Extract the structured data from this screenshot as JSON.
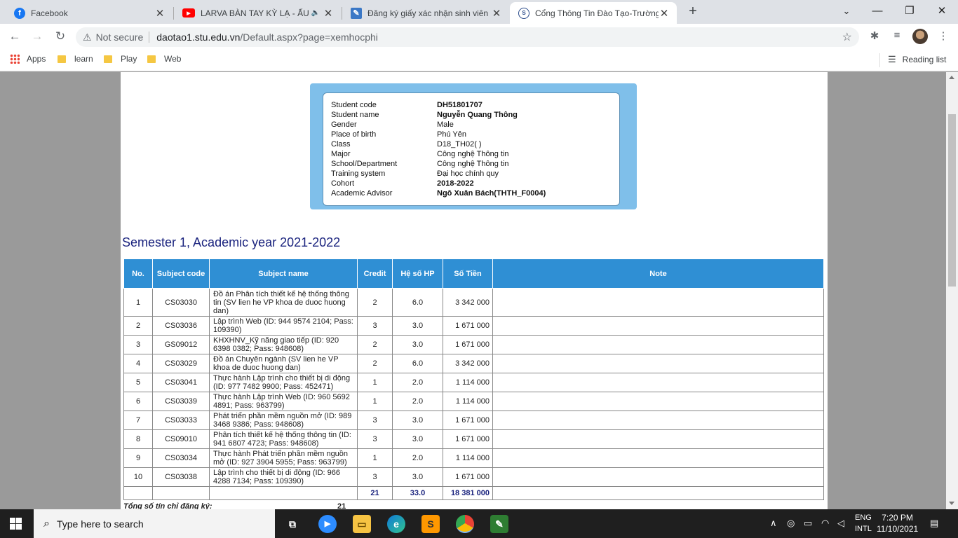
{
  "tabs": [
    {
      "title": "Facebook",
      "icon": "facebook-icon",
      "color": "#1877f2"
    },
    {
      "title": "LARVA BÀN TAY KỲ LẠ - ẤU TRÙNG",
      "icon": "youtube-icon",
      "color": "#ff0000"
    },
    {
      "title": "Đăng ký giấy xác nhận sinh viên",
      "icon": "site-icon",
      "color": "#3b78c6"
    },
    {
      "title": "Cổng Thông Tin Đào Tạo-Trường",
      "icon": "stu-icon",
      "color": "#2a4a8a"
    }
  ],
  "address": {
    "security": "Not secure",
    "host": "daotao1.stu.edu.vn",
    "path": "/Default.aspx?page=xemhocphi"
  },
  "bookmarks": {
    "apps": "Apps",
    "items": [
      "learn",
      "Play",
      "Web"
    ],
    "reading_list": "Reading list"
  },
  "student": {
    "rows": [
      {
        "label": "Student code",
        "value": "DH51801707",
        "bold": true
      },
      {
        "label": "Student name",
        "value": "Nguyễn Quang Thông",
        "bold": true
      },
      {
        "label": "Gender",
        "value": "Male",
        "bold": false
      },
      {
        "label": "Place of birth",
        "value": "Phú Yên",
        "bold": false
      },
      {
        "label": "Class",
        "value": "D18_TH02( )",
        "bold": false
      },
      {
        "label": "Major",
        "value": "Công nghệ Thông tin",
        "bold": false
      },
      {
        "label": "School/Department",
        "value": "Công nghệ Thông tin",
        "bold": false
      },
      {
        "label": "Training system",
        "value": "Đại học chính quy",
        "bold": false
      },
      {
        "label": "Cohort",
        "value": "2018-2022",
        "bold": true
      },
      {
        "label": "Academic Advisor",
        "value": "Ngô Xuân Bách(THTH_F0004)",
        "bold": true
      }
    ]
  },
  "semester_title": "Semester 1, Academic year 2021-2022",
  "table": {
    "headers": [
      "No.",
      "Subject code",
      "Subject name",
      "Credit",
      "Hệ số HP",
      "Số Tiền",
      "Note"
    ],
    "rows": [
      {
        "no": "1",
        "code": "CS03030",
        "name": "Đồ án Phân tích thiết kế hệ thống thông tin (SV lien he VP khoa de duoc huong dan)",
        "credit": "2",
        "coef": "6.0",
        "fee": "3 342 000",
        "tall": true
      },
      {
        "no": "2",
        "code": "CS03036",
        "name": "Lập trình Web (ID: 944 9574 2104; Pass: 109390)",
        "credit": "3",
        "coef": "3.0",
        "fee": "1 671 000"
      },
      {
        "no": "3",
        "code": "GS09012",
        "name": "KHXHNV_Kỹ năng giao tiếp (ID: 920 6398 0382; Pass: 948608)",
        "credit": "2",
        "coef": "3.0",
        "fee": "1 671 000"
      },
      {
        "no": "4",
        "code": "CS03029",
        "name": "Đồ án Chuyên ngành (SV lien he VP khoa de duoc huong dan)",
        "credit": "2",
        "coef": "6.0",
        "fee": "3 342 000"
      },
      {
        "no": "5",
        "code": "CS03041",
        "name": "Thực hành Lập trình cho thiết bị di động (ID: 977 7482 9900; Pass: 452471)",
        "credit": "1",
        "coef": "2.0",
        "fee": "1 114 000"
      },
      {
        "no": "6",
        "code": "CS03039",
        "name": "Thực hành Lập trình Web (ID: 960 5692 4891; Pass: 963799)",
        "credit": "1",
        "coef": "2.0",
        "fee": "1 114 000"
      },
      {
        "no": "7",
        "code": "CS03033",
        "name": "Phát triển phần mềm nguồn mở (ID: 989 3468 9386; Pass: 948608)",
        "credit": "3",
        "coef": "3.0",
        "fee": "1 671 000"
      },
      {
        "no": "8",
        "code": "CS09010",
        "name": "Phân tích thiết kế hệ thống thông tin (ID: 941 6807 4723; Pass: 948608)",
        "credit": "3",
        "coef": "3.0",
        "fee": "1 671 000"
      },
      {
        "no": "9",
        "code": "CS03034",
        "name": "Thực hành Phát triển phần mềm nguồn mở (ID: 927 3904 5955; Pass: 963799)",
        "credit": "1",
        "coef": "2.0",
        "fee": "1 114 000"
      },
      {
        "no": "10",
        "code": "CS03038",
        "name": "Lập trình cho thiết bị di động (ID: 966 4288 7134; Pass: 109390)",
        "credit": "3",
        "coef": "3.0",
        "fee": "1 671 000"
      }
    ],
    "totals": {
      "credit": "21",
      "coef": "33.0",
      "fee": "18 381 000"
    }
  },
  "total_credits": {
    "label": "Tổng số tín chỉ đăng ký:",
    "value": "21"
  },
  "taskbar": {
    "search_placeholder": "Type here to search",
    "lang_top": "ENG",
    "lang_bottom": "INTL",
    "time": "7:20 PM",
    "date": "11/10/2021"
  }
}
